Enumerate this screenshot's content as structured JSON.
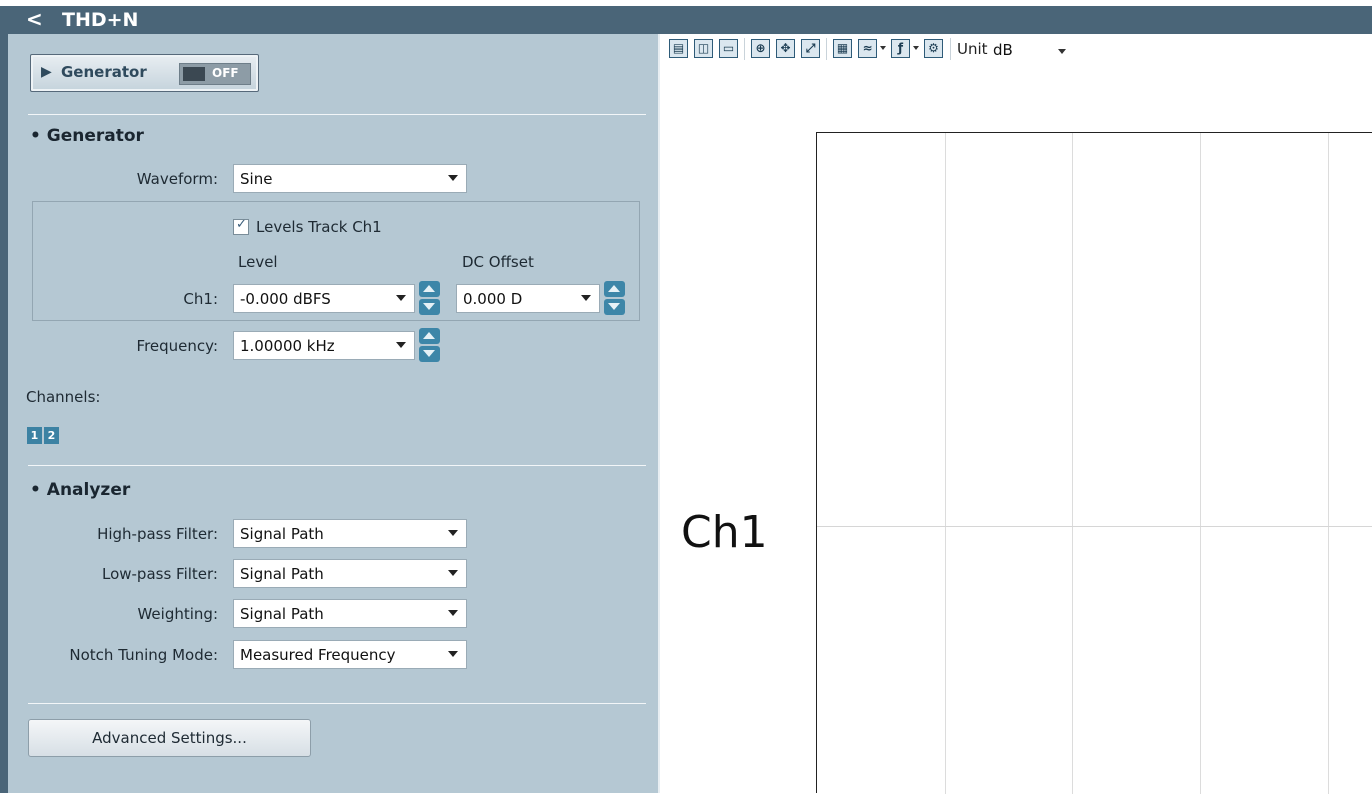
{
  "header": {
    "title": "THD+N",
    "back_glyph": "<"
  },
  "generator_button": {
    "label": "Generator",
    "state": "OFF"
  },
  "generator_section": {
    "heading": "• Generator",
    "waveform_label": "Waveform:",
    "waveform_value": "Sine",
    "levels_track_label": "Levels Track Ch1",
    "levels_track_checked": true,
    "level_header": "Level",
    "dc_offset_header": "DC Offset",
    "ch1_label": "Ch1:",
    "ch1_level": "-0.000 dBFS",
    "ch1_dc_offset": "0.000 D",
    "frequency_label": "Frequency:",
    "frequency_value": "1.00000 kHz",
    "channels_label": "Channels:",
    "channel_buttons": [
      "1",
      "2"
    ]
  },
  "analyzer_section": {
    "heading": "• Analyzer",
    "high_pass_label": "High-pass Filter:",
    "high_pass_value": "Signal Path",
    "low_pass_label": "Low-pass Filter:",
    "low_pass_value": "Signal Path",
    "weighting_label": "Weighting:",
    "weighting_value": "Signal Path",
    "notch_label": "Notch Tuning Mode:",
    "notch_value": "Measured Frequency"
  },
  "advanced_button": "Advanced Settings...",
  "toolbar": {
    "unit_label": "Unit",
    "unit_value": "dB"
  },
  "graph": {
    "channel_label": "Ch1"
  },
  "colors": {
    "titlebar": "#4a6578",
    "panel": "#b5c8d3",
    "accent": "#3d86a8"
  }
}
